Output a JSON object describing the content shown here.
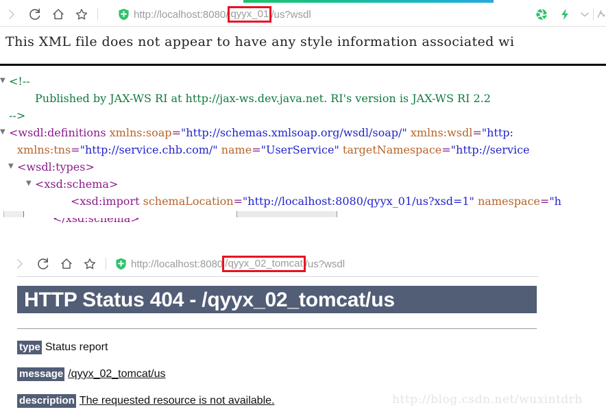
{
  "browser1": {
    "toolbar": {
      "forward_icon": "chevron-right-icon",
      "reload_icon": "reload-icon",
      "home_icon": "home-icon",
      "bookmark_icon": "star-icon",
      "shield_icon": "security-shield-icon",
      "extension_aperture_icon": "aperture-icon",
      "extension_bolt_icon": "lightning-bolt-icon",
      "dropdown_icon": "chevron-down-icon"
    },
    "url": {
      "scheme": "http://",
      "host": "localhost",
      "port": ":8080",
      "slash": "/",
      "highlighted_path": "qyyx_01",
      "rest": "/us?wsdl",
      "full": "http://localhost:8080/qyyx_01/us?wsdl",
      "highlight_color": "#e81123"
    }
  },
  "xml_page": {
    "notice": "This XML file does not appear to have any style information associated wi",
    "lines": [
      {
        "indent": 0,
        "twisty": "▼",
        "parts": [
          {
            "cls": "cmt",
            "t": "<!--"
          }
        ]
      },
      {
        "indent": 2,
        "twisty": "",
        "parts": [
          {
            "cls": "cmt",
            "t": "Published by JAX-WS RI at http://jax-ws.dev.java.net. RI's version is JAX-WS RI 2.2"
          }
        ]
      },
      {
        "indent": 0,
        "twisty": "",
        "parts": [
          {
            "cls": "cmt",
            "t": "-->"
          }
        ]
      },
      {
        "indent": 0,
        "twisty": "▼",
        "parts": [
          {
            "cls": "punc",
            "t": "<"
          },
          {
            "cls": "tag",
            "t": "wsdl:definitions"
          },
          {
            "cls": "attr",
            "t": " xmlns:soap"
          },
          {
            "cls": "punc",
            "t": "="
          },
          {
            "cls": "val",
            "t": "\"http://schemas.xmlsoap.org/wsdl/soap/\""
          },
          {
            "cls": "attr",
            "t": " xmlns:wsdl"
          },
          {
            "cls": "punc",
            "t": "="
          },
          {
            "cls": "val",
            "t": "\"http:"
          }
        ]
      },
      {
        "indent": 1,
        "twisty": "",
        "parts": [
          {
            "cls": "attr",
            "t": "xmlns:tns"
          },
          {
            "cls": "punc",
            "t": "="
          },
          {
            "cls": "val",
            "t": "\"http://service.chb.com/\""
          },
          {
            "cls": "attr",
            "t": " name"
          },
          {
            "cls": "punc",
            "t": "="
          },
          {
            "cls": "val",
            "t": "\"UserService\""
          },
          {
            "cls": "attr",
            "t": " targetNamespace"
          },
          {
            "cls": "punc",
            "t": "="
          },
          {
            "cls": "val",
            "t": "\"http://service"
          }
        ]
      },
      {
        "indent": 1,
        "twisty": "▼",
        "parts": [
          {
            "cls": "punc",
            "t": "<"
          },
          {
            "cls": "tag",
            "t": "wsdl:types"
          },
          {
            "cls": "punc",
            "t": ">"
          }
        ]
      },
      {
        "indent": 2,
        "twisty": "▼",
        "parts": [
          {
            "cls": "punc",
            "t": "<"
          },
          {
            "cls": "tag",
            "t": "xsd:schema"
          },
          {
            "cls": "punc",
            "t": ">"
          }
        ]
      },
      {
        "indent": 4,
        "twisty": "",
        "parts": [
          {
            "cls": "punc",
            "t": "<"
          },
          {
            "cls": "tag",
            "t": "xsd:import"
          },
          {
            "cls": "attr",
            "t": " schemaLocation"
          },
          {
            "cls": "punc",
            "t": "="
          },
          {
            "cls": "val",
            "t": "\"http://localhost:8080/qyyx_01/us?xsd=1\""
          },
          {
            "cls": "attr",
            "t": " namespace"
          },
          {
            "cls": "punc",
            "t": "="
          },
          {
            "cls": "val",
            "t": "\"h"
          }
        ]
      },
      {
        "indent": 3,
        "twisty": "",
        "parts": [
          {
            "cls": "punc",
            "t": "</"
          },
          {
            "cls": "tag",
            "t": "xsd:schema"
          },
          {
            "cls": "punc",
            "t": ">"
          }
        ]
      }
    ]
  },
  "browser2": {
    "toolbar": {
      "forward_icon": "chevron-right-icon",
      "reload_icon": "reload-icon",
      "home_icon": "home-icon",
      "bookmark_icon": "star-icon",
      "shield_icon": "security-shield-icon"
    },
    "url": {
      "scheme": "http://",
      "host": "localhost",
      "port": ":8080",
      "slash": "",
      "highlighted_path": "/qyyx_02_tomcat",
      "rest": "/us?wsdl",
      "full": "http://localhost:8080/qyyx_02_tomcat/us?wsdl",
      "highlight_color": "#e81123"
    }
  },
  "error_page": {
    "title": "HTTP Status 404 - /qyyx_02_tomcat/us",
    "banner_color": "#525d76",
    "rows": [
      {
        "label": "type",
        "value": "Status report",
        "underline": false
      },
      {
        "label": "message",
        "value": "/qyyx_02_tomcat/us",
        "underline": true
      },
      {
        "label": "description",
        "value": "The requested resource is not available.",
        "underline": true
      }
    ]
  },
  "watermark": {
    "text": "http://blog.csdn.net/wuxintdrh"
  }
}
